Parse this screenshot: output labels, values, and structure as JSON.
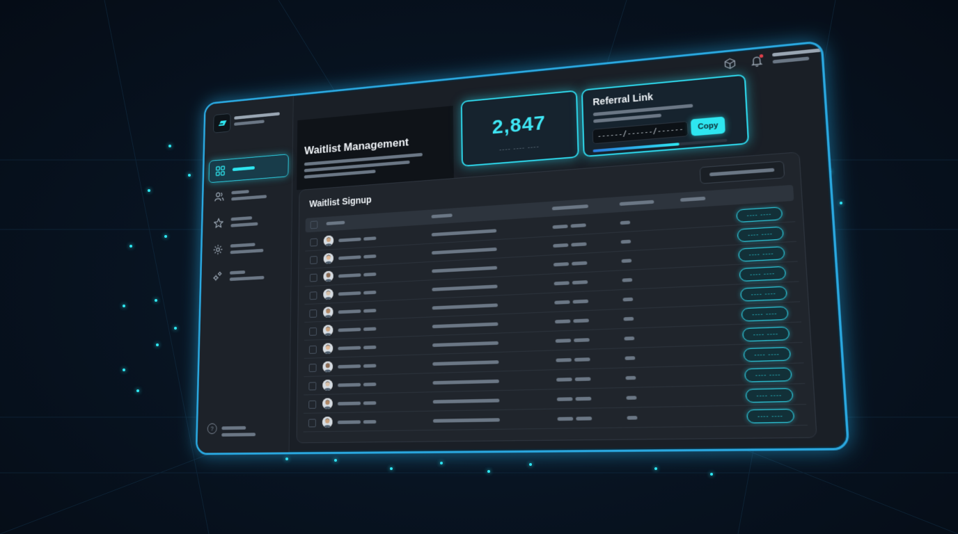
{
  "header": {
    "title": "Waitlist Management"
  },
  "stats": {
    "count": "2,847",
    "count_sub": "---- ---- ----"
  },
  "referral": {
    "title": "Referral Link",
    "link_value": "------/------/------",
    "copy_label": "Copy",
    "progress": 0.65
  },
  "table": {
    "title": "Waitlist Signup",
    "rows": [
      {
        "status": "---- ----"
      },
      {
        "status": "---- ----"
      },
      {
        "status": "---- ----"
      },
      {
        "status": "---- ----"
      },
      {
        "status": "---- ----"
      },
      {
        "status": "---- ----"
      },
      {
        "status": "---- ----"
      },
      {
        "status": "---- ----"
      },
      {
        "status": "---- ----"
      },
      {
        "status": "---- ----"
      },
      {
        "status": "---- ----"
      }
    ]
  },
  "sidebar": {
    "items": [
      {
        "icon": "dashboard-grid-icon",
        "active": true
      },
      {
        "icon": "users-icon",
        "active": false
      },
      {
        "icon": "star-icon",
        "active": false
      },
      {
        "icon": "settings-icon",
        "active": false
      },
      {
        "icon": "integrations-gear-icon",
        "active": false
      }
    ],
    "help_icon": "help-icon",
    "help_glyph": "?"
  },
  "topbar": {
    "icons": [
      "package-icon",
      "bell-icon",
      "chevron-down-icon"
    ]
  },
  "colors": {
    "accent": "#2ee6f0",
    "glow": "#2aa8e0",
    "background": "#081422",
    "panel": "#20252c"
  }
}
